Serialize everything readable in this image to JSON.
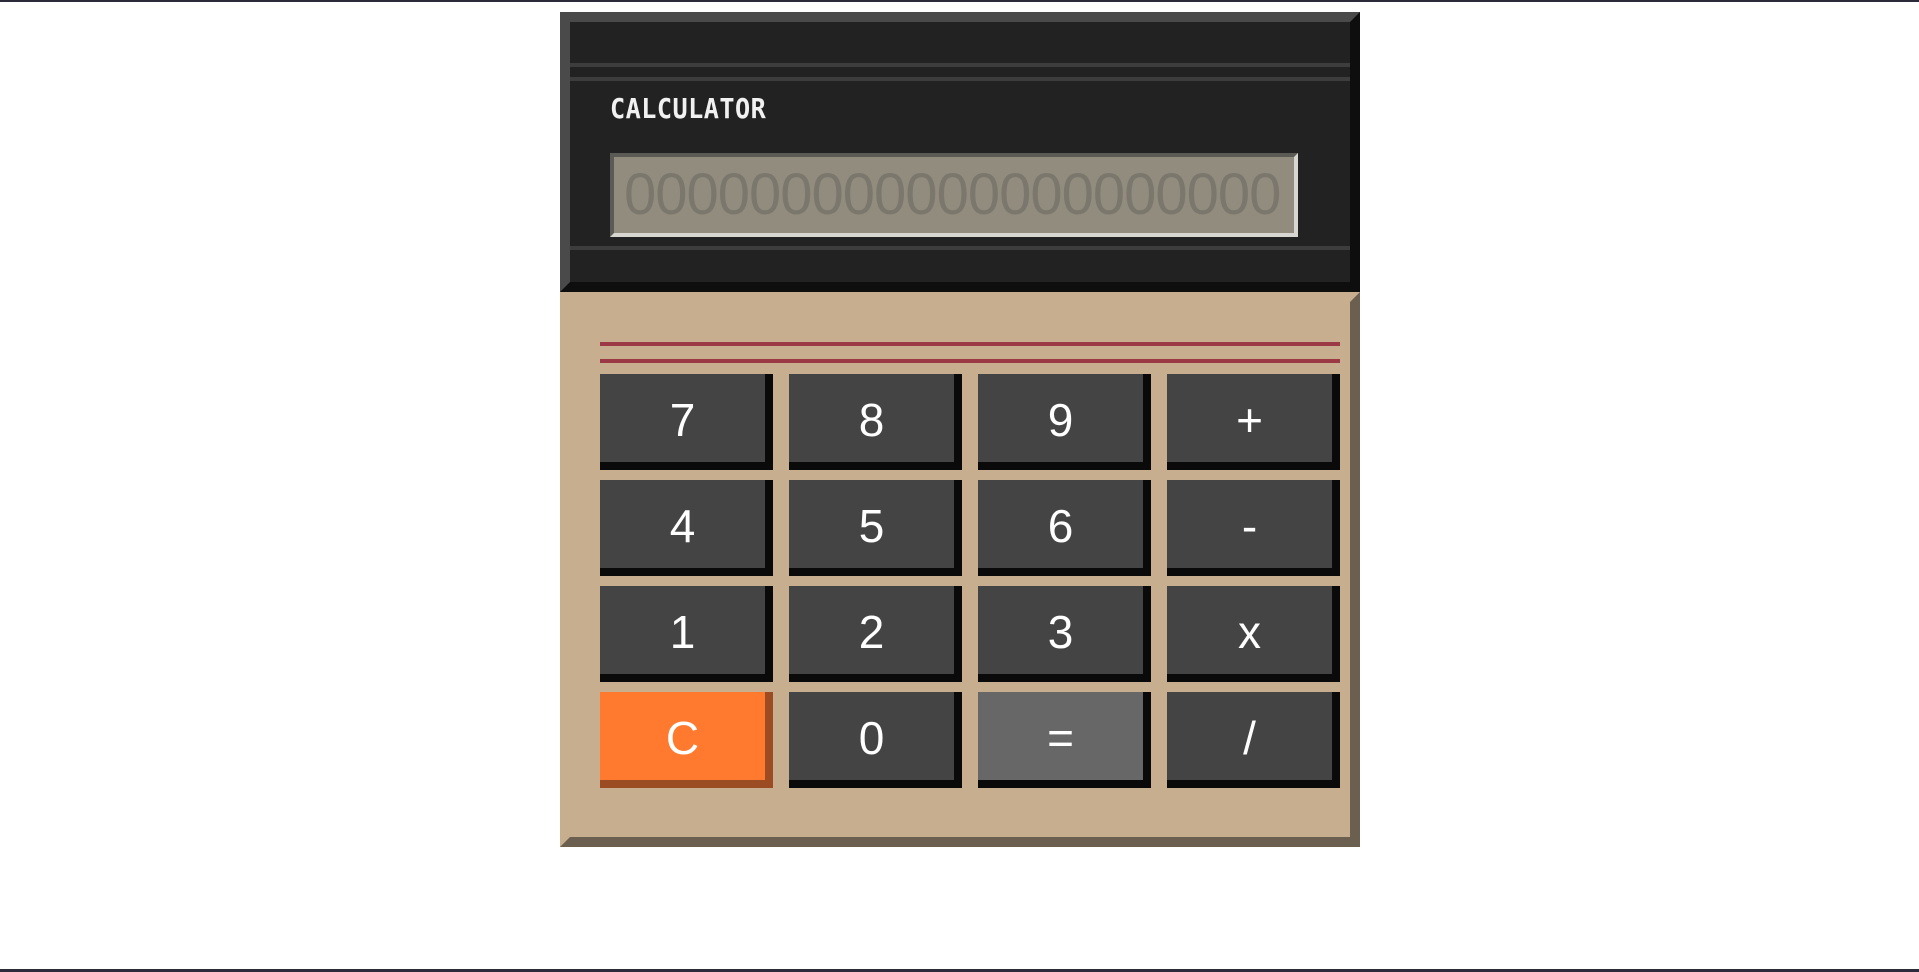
{
  "calculator": {
    "brand": "CALCULATOR",
    "display_value": "000000000000000000000",
    "keys": {
      "seven": "7",
      "eight": "8",
      "nine": "9",
      "plus": "+",
      "four": "4",
      "five": "5",
      "six": "6",
      "minus": "-",
      "one": "1",
      "two": "2",
      "three": "3",
      "multiply": "x",
      "clear": "C",
      "zero": "0",
      "equals": "=",
      "divide": "/"
    }
  },
  "colors": {
    "head": "#222222",
    "body": "#c7ae8e",
    "display": "#928c7e",
    "key": "#444444",
    "clear_key": "#ff7a2f",
    "equals_key": "#676767",
    "stripe": "#9b3a44"
  }
}
